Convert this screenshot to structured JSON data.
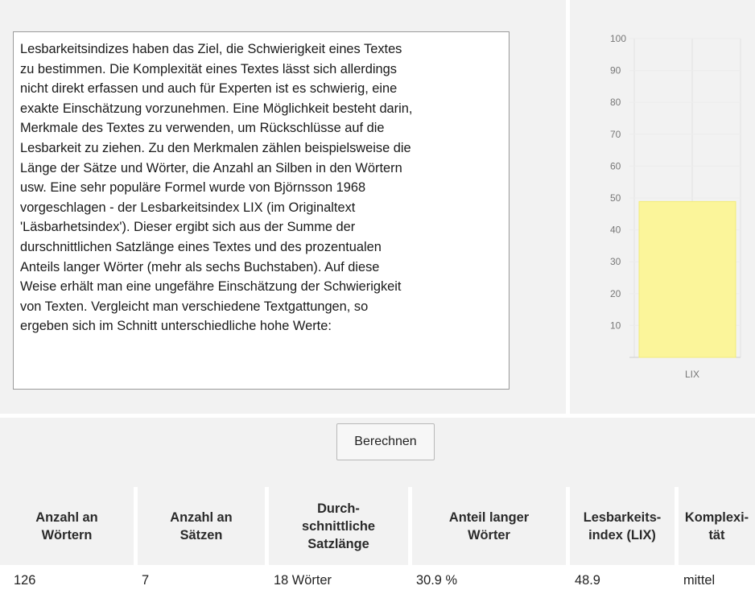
{
  "text_input": {
    "value": "Lesbarkeitsindizes haben das Ziel, die Schwierigkeit eines Textes\nzu bestimmen. Die Komplexität eines Textes lässt sich allerdings\nnicht direkt erfassen und auch für Experten ist es schwierig, eine\nexakte Einschätzung vorzunehmen. Eine Möglichkeit besteht darin,\nMerkmale des Textes zu verwenden, um Rückschlüsse auf die\nLesbarkeit zu ziehen. Zu den Merkmalen zählen beispielsweise die\nLänge der Sätze und Wörter, die Anzahl an Silben in den Wörtern\nusw. Eine sehr populäre Formel wurde von Björnsson 1968\nvorgeschlagen - der Lesbarkeitsindex LIX (im Originaltext\n'Läsbarhetsindex'). Dieser ergibt sich aus der Summe der\ndurschnittlichen Satzlänge eines Textes und des prozentualen\nAnteils langer Wörter (mehr als sechs Buchstaben). Auf diese\nWeise erhält man eine ungefähre Einschätzung der Schwierigkeit\nvon Texten. Vergleicht man verschiedene Textgattungen, so\nergeben sich im Schnitt unterschiedliche hohe Werte:"
  },
  "chart_data": {
    "type": "bar",
    "categories": [
      "LIX"
    ],
    "values": [
      48.9
    ],
    "ylim": [
      0,
      100
    ],
    "yticks": [
      10,
      20,
      30,
      40,
      50,
      60,
      70,
      80,
      90,
      100
    ],
    "grid": true,
    "bar_color": "#fbf59a",
    "bar_edge": "#f3ec7a"
  },
  "actions": {
    "calculate_label": "Berechnen"
  },
  "results": {
    "headers": [
      "Anzahl an\nWörtern",
      "Anzahl an\nSätzen",
      "Durch-\nschnittliche\nSatzlänge",
      "Anteil langer\nWörter",
      "Lesbarkeits-\nindex (LIX)",
      "Komplexi-\ntät"
    ],
    "values": [
      "126",
      "7",
      "18 Wörter",
      "30.9 %",
      "48.9",
      "mittel"
    ]
  }
}
